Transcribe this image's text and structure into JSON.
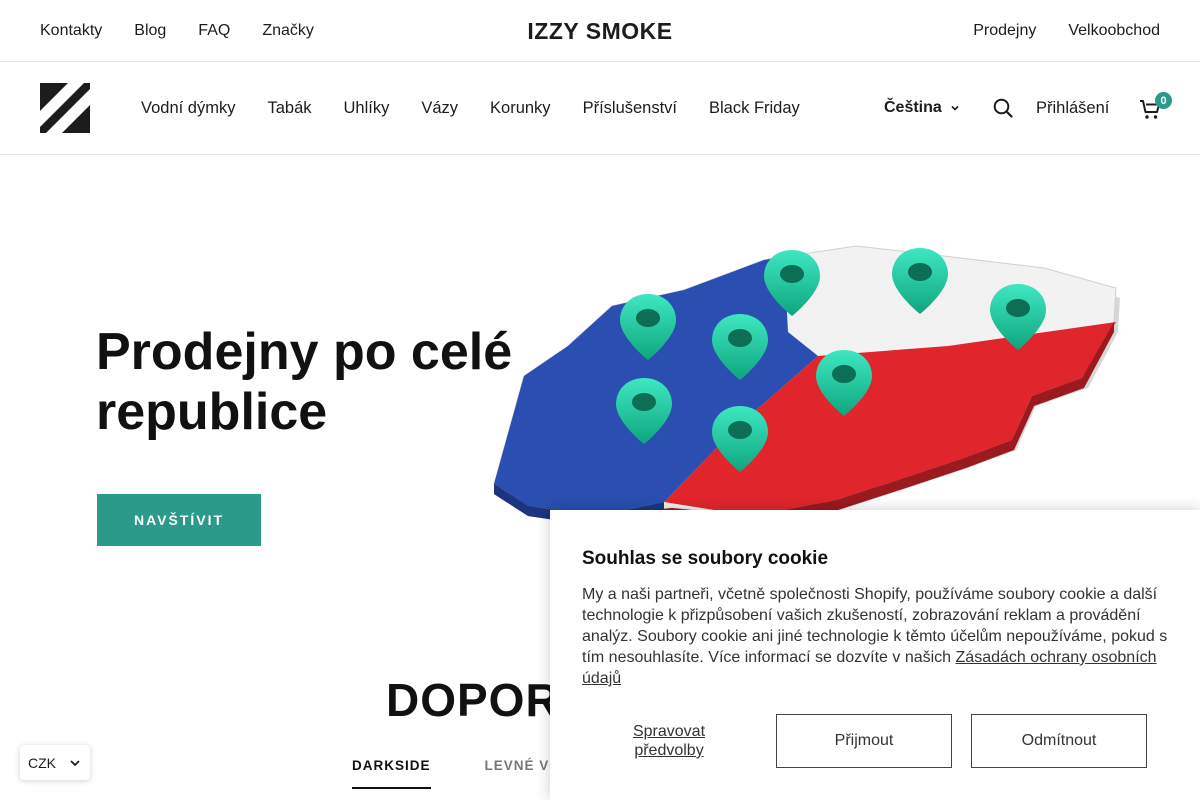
{
  "topbar": {
    "left_links": [
      "Kontakty",
      "Blog",
      "FAQ",
      "Značky"
    ],
    "brand": "IZZY SMOKE",
    "right_links": [
      "Prodejny",
      "Velkoobchod"
    ]
  },
  "nav": {
    "items": [
      "Vodní dýmky",
      "Tabák",
      "Uhlíky",
      "Vázy",
      "Korunky",
      "Příslušenství",
      "Black Friday"
    ],
    "language": "Čeština",
    "login": "Přihlášení",
    "cart_count": "0"
  },
  "hero": {
    "title": "Prodejny po celé republice",
    "button": "NAVŠTÍVIT"
  },
  "section": {
    "title": "DOPORUČUJEME",
    "tabs": [
      "DARKSIDE",
      "LEVNÉ VODNÍ DÝMKY"
    ]
  },
  "currency": "CZK",
  "cookie": {
    "title": "Souhlas se soubory cookie",
    "text": "My a naši partneři, včetně společnosti Shopify, používáme soubory cookie a další technologie k přizpůsobení vašich zkušeností, zobrazování reklam a provádění analýz. Soubory cookie ani jiné technologie k těmto účelům nepoužíváme, pokud s tím nesouhlasíte. Více informací se dozvíte v našich",
    "link": "Zásadách ochrany osobních údajů",
    "manage": "Spravovat předvolby",
    "accept": "Přijmout",
    "decline": "Odmítnout"
  },
  "colors": {
    "accent": "#2b9a8a",
    "flag_blue": "#2a4fb0",
    "flag_red": "#e0262c",
    "pin_green": "#19c9a0"
  }
}
